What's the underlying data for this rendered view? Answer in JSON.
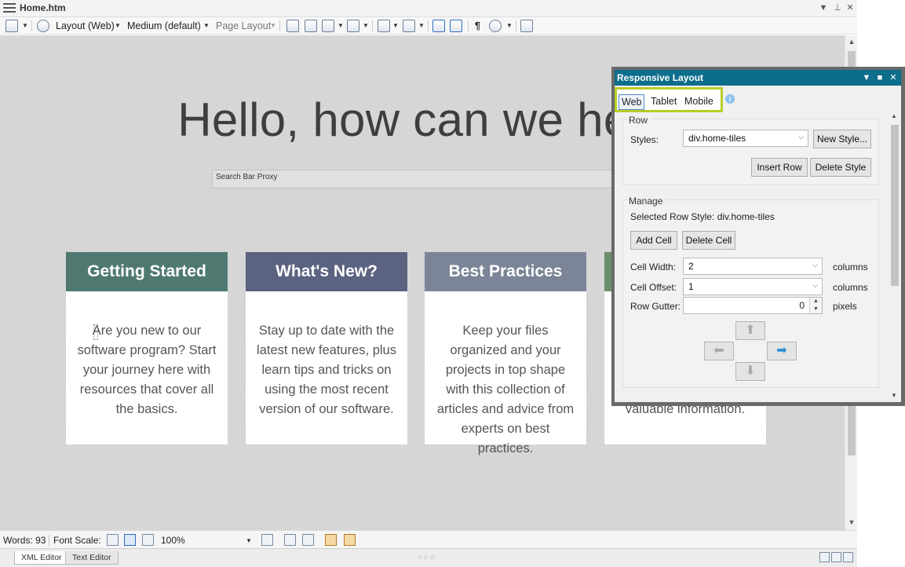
{
  "window": {
    "title": "Home.htm"
  },
  "toolbar": {
    "layout_label": "Layout (Web)",
    "medium_label": "Medium (default)",
    "page_layout_label": "Page Layout",
    "pilcrow": "¶"
  },
  "canvas": {
    "hero_title": "Hello, how can we help",
    "search_placeholder": "Search Bar Proxy",
    "tiles": [
      {
        "title": "Getting Started",
        "body": "Are you new to our software program? Start your journey here with resources that cover all the basics.",
        "color": "#4f7970"
      },
      {
        "title": "What's New?",
        "body": "Stay up to date with the latest new features, plus learn tips and tricks on using the most recent version of our software.",
        "color": "#5c6380"
      },
      {
        "title": "Best Practices",
        "body": "Keep your files organized and your projects in top shape with this collection of articles and advice from experts on best practices.",
        "color": "#7c8597"
      },
      {
        "title": "",
        "body": "valuable information.",
        "color": "#6a8e6f"
      }
    ]
  },
  "status": {
    "words": "Words: 93",
    "font_scale_label": "Font Scale:",
    "zoom": "100%"
  },
  "bottom_tabs": [
    "XML Editor",
    "Text Editor"
  ],
  "panel": {
    "title": "Responsive Layout",
    "tabs": [
      "Web",
      "Tablet",
      "Mobile"
    ],
    "selected_tab": "Web",
    "highlight_color": "#b8cc26",
    "title_color": "#0d6e8c",
    "row": {
      "group_label": "Row",
      "styles_label": "Styles:",
      "styles_value": "div.home-tiles",
      "new_style": "New Style...",
      "insert_row": "Insert Row",
      "delete_style": "Delete Style"
    },
    "manage": {
      "group_label": "Manage",
      "selected_row_style": "Selected Row Style: div.home-tiles",
      "add_cell": "Add Cell",
      "delete_cell": "Delete Cell",
      "cell_width_label": "Cell Width:",
      "cell_width_value": "2",
      "cell_width_unit": "columns",
      "cell_offset_label": "Cell Offset:",
      "cell_offset_value": "1",
      "cell_offset_unit": "columns",
      "row_gutter_label": "Row Gutter:",
      "row_gutter_value": "0",
      "row_gutter_unit": "pixels"
    }
  }
}
